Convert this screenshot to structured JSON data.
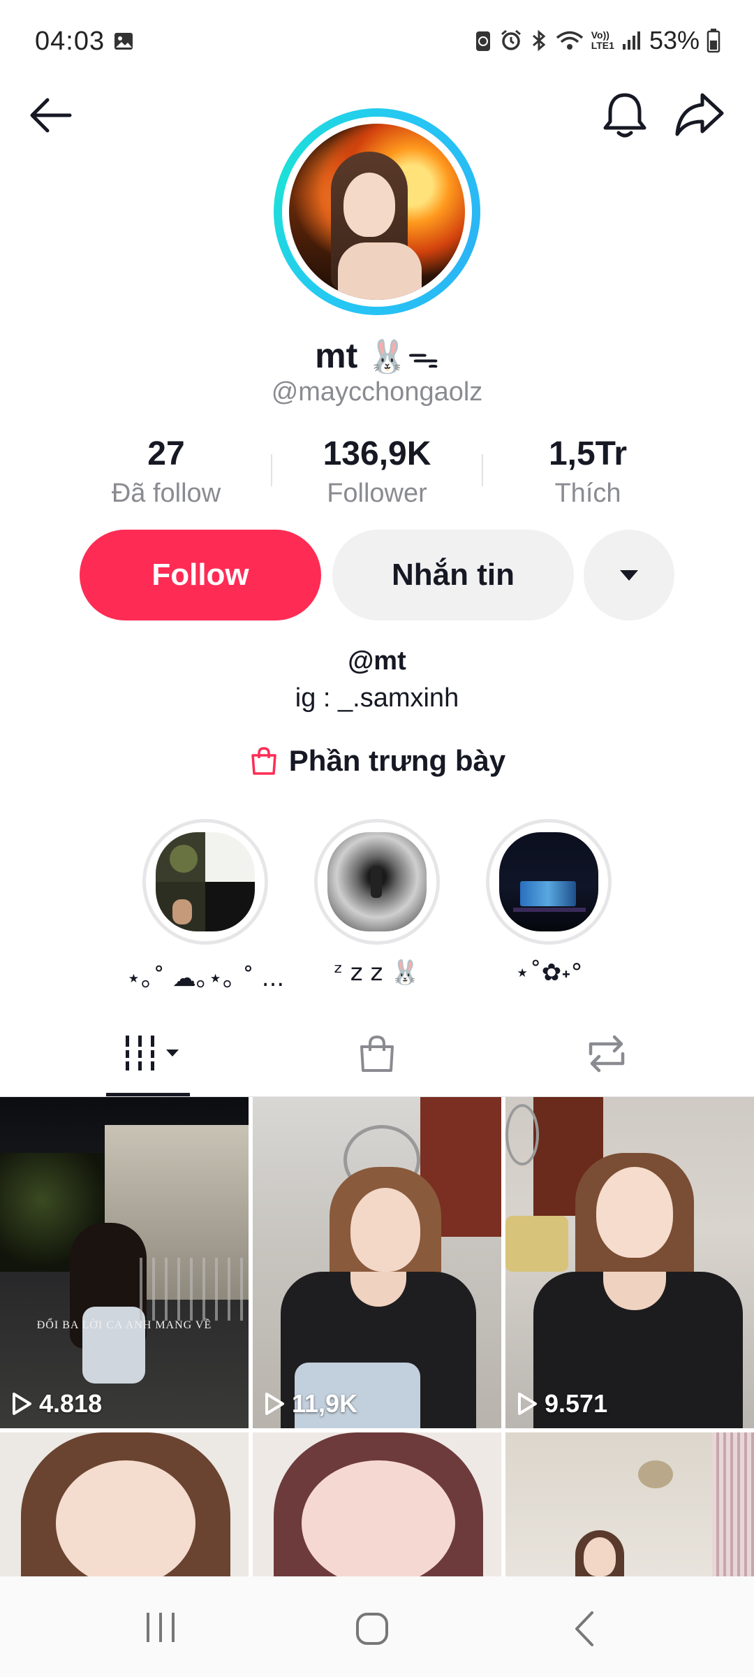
{
  "status_bar": {
    "time": "04:03",
    "battery": "53%",
    "icons": [
      "image-icon",
      "sync-icon",
      "alarm-icon",
      "bluetooth-icon",
      "wifi-icon",
      "volte-icon",
      "signal-icon",
      "battery-icon"
    ],
    "volte_top": "Vo))",
    "volte_bottom": "LTE1"
  },
  "header": {
    "back_icon": "arrow-left-icon",
    "bell_icon": "bell-icon",
    "share_icon": "share-arrow-icon"
  },
  "profile": {
    "display_name": "mt",
    "name_emoji": "🐰ᯓ",
    "username": "@maycchongaolz",
    "ring_color": "#25c6f4"
  },
  "stats": [
    {
      "value": "27",
      "label": "Đã follow"
    },
    {
      "value": "136,9K",
      "label": "Follower"
    },
    {
      "value": "1,5Tr",
      "label": "Thích"
    }
  ],
  "actions": {
    "follow_label": "Follow",
    "message_label": "Nhắn tin",
    "follow_color": "#fe2c55"
  },
  "bio": {
    "line1": "@mt",
    "line2": "ig : _.samxinh",
    "showcase_label": "Phần trưng bày"
  },
  "highlights": [
    {
      "label": "⋆｡˚ ☁︎｡⋆｡ ˚ ..."
    },
    {
      "label": "ᶻ z 𝗓 🐰"
    },
    {
      "label": "⋆˚✿˖°"
    }
  ],
  "tabs": [
    {
      "name": "videos",
      "icon": "grid-icon",
      "active": true
    },
    {
      "name": "shop",
      "icon": "shopping-bag-icon",
      "active": false
    },
    {
      "name": "reposts",
      "icon": "repost-icon",
      "active": false
    }
  ],
  "videos": [
    {
      "views": "4.818",
      "overlay": "ĐỔI BA LỜI CA ANH MANG VỀ"
    },
    {
      "views": "11,9K"
    },
    {
      "views": "9.571"
    },
    {},
    {},
    {}
  ]
}
